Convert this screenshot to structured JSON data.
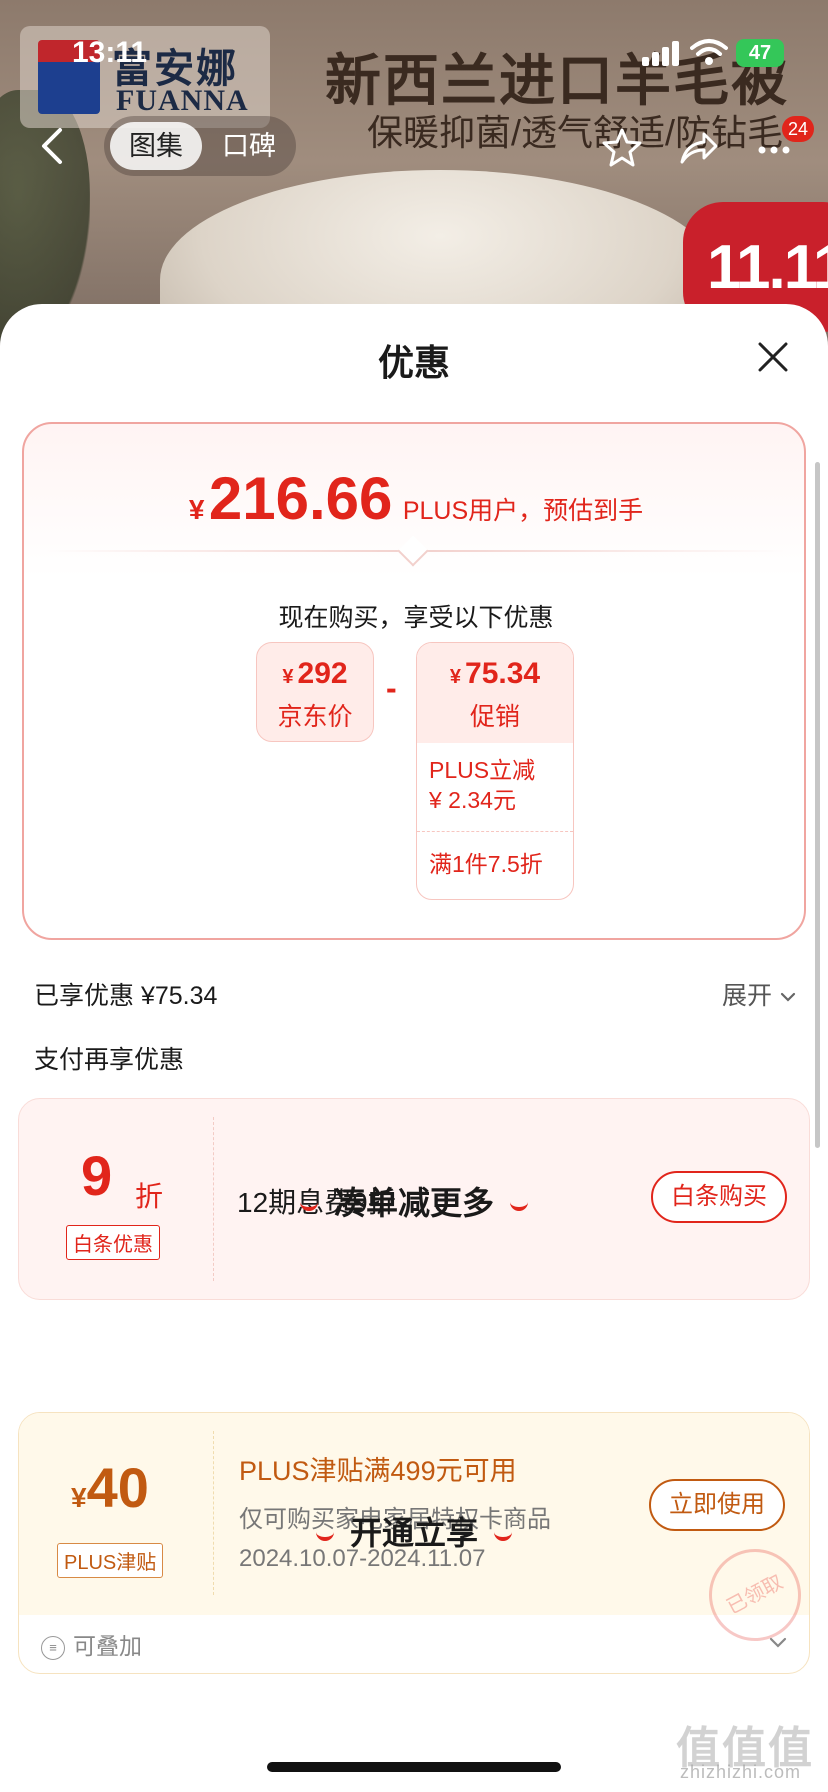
{
  "status_bar": {
    "time": "13:11",
    "battery": "47"
  },
  "product_banner": {
    "brand_cn": "富安娜",
    "brand_en": "FUANNA",
    "title": "新西兰进口羊毛被",
    "subtitle": "保暖抑菌/透气舒适/防钻毛",
    "promo_tag": "11.11"
  },
  "nav": {
    "tabs": [
      "图集",
      "口碑"
    ],
    "message_badge": "24"
  },
  "sheet": {
    "title": "优惠",
    "price": {
      "currency": "¥",
      "amount": "216.66",
      "note": "PLUS用户，预估到手"
    },
    "buy_now_text": "现在购买，享受以下优惠",
    "jd_price": {
      "currency": "¥",
      "value": "292",
      "label": "京东价"
    },
    "minus": "-",
    "promo": {
      "currency": "¥",
      "value": "75.34",
      "label": "促销",
      "detail_line1": "PLUS立减",
      "detail_line2": "¥ 2.34元",
      "detail_3": "满1件7.5折"
    },
    "enjoyed": "已享优惠 ¥75.34",
    "expand": "展开",
    "pay_more": "支付再享优惠",
    "baitiao_coupon": {
      "value": "9",
      "unit": "折",
      "tag": "白条优惠",
      "description": "12期息费9折",
      "button": "白条购买"
    },
    "section_more": "凑单减更多",
    "plus_coupon": {
      "currency": "¥",
      "value": "40",
      "tag": "PLUS津贴",
      "title": "PLUS津贴满499元可用",
      "desc": "仅可购买家电家居特权卡商品",
      "validity": "2024.10.07-2024.11.07",
      "button": "立即使用",
      "stamp": "已领取",
      "stackable": "可叠加"
    },
    "section_open": "开通立享"
  },
  "watermark": {
    "main": "值值值",
    "sub": "zhizhizhi.com"
  },
  "colors": {
    "accent": "#e1251b",
    "plus_orange": "#c15a11"
  }
}
